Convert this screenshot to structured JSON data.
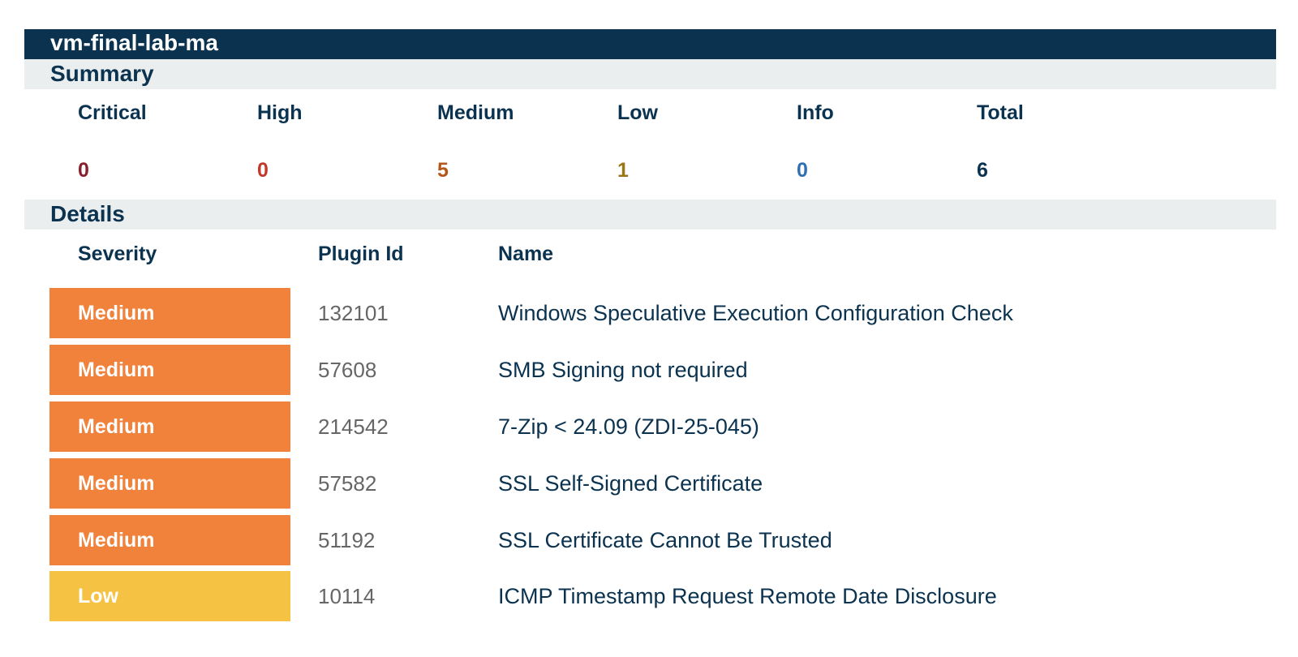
{
  "host": "vm-final-lab-ma",
  "summary": {
    "title": "Summary",
    "items": [
      {
        "label": "Critical",
        "value": "0",
        "color": "#8b1e2b"
      },
      {
        "label": "High",
        "value": "0",
        "color": "#c0392b"
      },
      {
        "label": "Medium",
        "value": "5",
        "color": "#b5561a"
      },
      {
        "label": "Low",
        "value": "1",
        "color": "#9a7615"
      },
      {
        "label": "Info",
        "value": "0",
        "color": "#2f6fb6"
      },
      {
        "label": "Total",
        "value": "6",
        "color": "#0b3350"
      }
    ]
  },
  "details": {
    "title": "Details",
    "headers": {
      "severity": "Severity",
      "plugin_id": "Plugin Id",
      "name": "Name"
    },
    "rows": [
      {
        "severity": "Medium",
        "plugin_id": "132101",
        "name": "Windows Speculative Execution Configuration Check",
        "color": "#f0823c"
      },
      {
        "severity": "Medium",
        "plugin_id": "57608",
        "name": "SMB Signing not required",
        "color": "#f0823c"
      },
      {
        "severity": "Medium",
        "plugin_id": "214542",
        "name": "7-Zip < 24.09 (ZDI-25-045)",
        "color": "#f0823c"
      },
      {
        "severity": "Medium",
        "plugin_id": "57582",
        "name": "SSL Self-Signed Certificate",
        "color": "#f0823c"
      },
      {
        "severity": "Medium",
        "plugin_id": "51192",
        "name": "SSL Certificate Cannot Be Trusted",
        "color": "#f0823c"
      },
      {
        "severity": "Low",
        "plugin_id": "10114",
        "name": "ICMP Timestamp Request Remote Date Disclosure",
        "color": "#f5c244"
      }
    ]
  }
}
